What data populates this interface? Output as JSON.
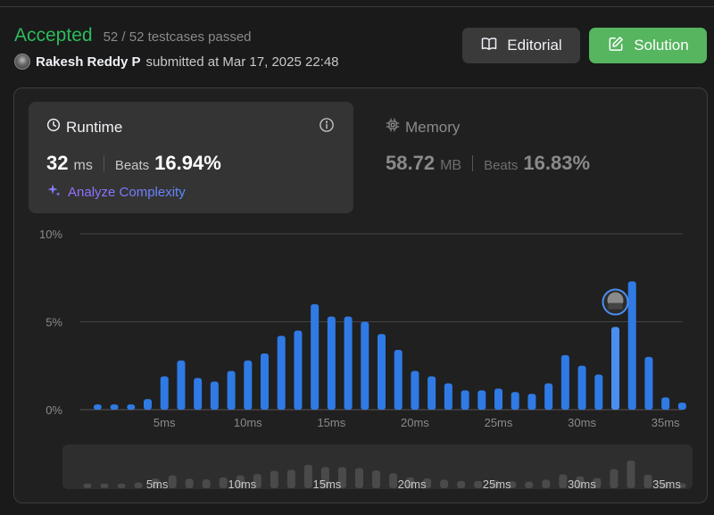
{
  "submission": {
    "status": "Accepted",
    "testcases": "52 / 52 testcases passed",
    "user": "Rakesh Reddy P",
    "submitted_text": "submitted at Mar 17, 2025 22:48"
  },
  "buttons": {
    "editorial": "Editorial",
    "solution": "Solution"
  },
  "runtime": {
    "title": "Runtime",
    "value": "32",
    "unit": "ms",
    "beats_label": "Beats",
    "beats_value": "16.94%",
    "analyze": "Analyze Complexity"
  },
  "memory": {
    "title": "Memory",
    "value": "58.72",
    "unit": "MB",
    "beats_label": "Beats",
    "beats_value": "16.83%"
  },
  "colors": {
    "accepted": "#2cbb5d",
    "bar": "#2f7ae5",
    "bar_highlight": "#4a8ef0",
    "solution_button": "#56b55f"
  },
  "chart_data": {
    "type": "bar",
    "y_ticks": [
      "10%",
      "5%",
      "0%"
    ],
    "ylim": [
      0,
      10
    ],
    "x_ticks": [
      "5ms",
      "10ms",
      "15ms",
      "20ms",
      "25ms",
      "30ms",
      "35ms"
    ],
    "x_tick_values": [
      5,
      10,
      15,
      20,
      25,
      30,
      35
    ],
    "xlim": [
      0.5,
      35.5
    ],
    "x": [
      1,
      2,
      3,
      4,
      5,
      6,
      7,
      8,
      9,
      10,
      11,
      12,
      13,
      14,
      15,
      16,
      17,
      18,
      19,
      20,
      21,
      22,
      23,
      24,
      25,
      26,
      27,
      28,
      29,
      30,
      31,
      32,
      33,
      34,
      35
    ],
    "values": [
      0.3,
      0.3,
      0.3,
      0.6,
      1.9,
      2.8,
      1.8,
      1.6,
      2.2,
      2.8,
      3.2,
      4.2,
      4.5,
      6.0,
      5.3,
      5.3,
      5.0,
      4.3,
      3.4,
      2.2,
      1.9,
      1.5,
      1.1,
      1.1,
      1.2,
      1.0,
      0.9,
      1.5,
      3.1,
      2.5,
      2.0,
      4.7,
      7.3,
      3.0,
      0.7,
      0.4
    ],
    "highlight_x": 32,
    "grid": true
  }
}
